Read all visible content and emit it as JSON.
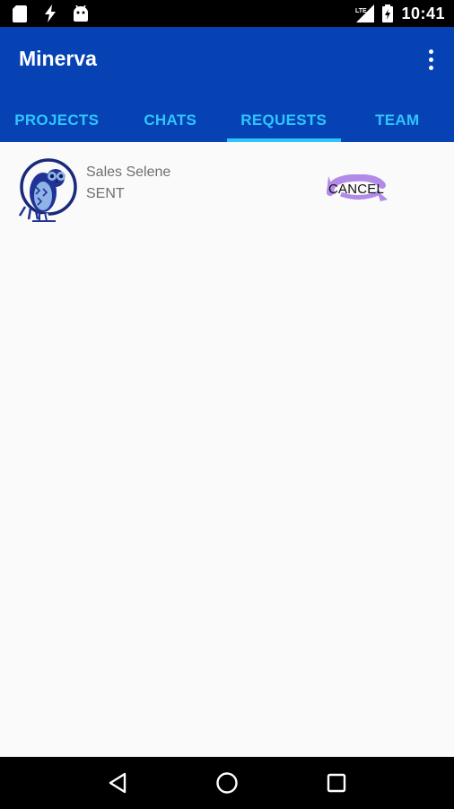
{
  "status_bar": {
    "time": "10:41",
    "left_icons": [
      "sd-card-icon",
      "lightning-icon",
      "android-icon"
    ],
    "right_icons": [
      "lte-signal-icon",
      "battery-charging-icon"
    ],
    "network_label": "LTE"
  },
  "app_bar": {
    "title": "Minerva",
    "menu_icon": "more-vert-icon",
    "color": "#0642b4"
  },
  "tabs": [
    {
      "label": "PROJECTS",
      "active": false
    },
    {
      "label": "CHATS",
      "active": false
    },
    {
      "label": "REQUESTS",
      "active": true
    },
    {
      "label": "TEAM",
      "active": false
    }
  ],
  "accent_color": "#2ec5ff",
  "requests": [
    {
      "name": "Sales Selene",
      "status": "SENT",
      "avatar_icon": "owl-logo-icon",
      "action_label": "CANCEL",
      "action_icon": "cancel-swirl-icon"
    }
  ],
  "nav_bar": {
    "buttons": [
      "back-icon",
      "home-icon",
      "recents-icon"
    ]
  }
}
